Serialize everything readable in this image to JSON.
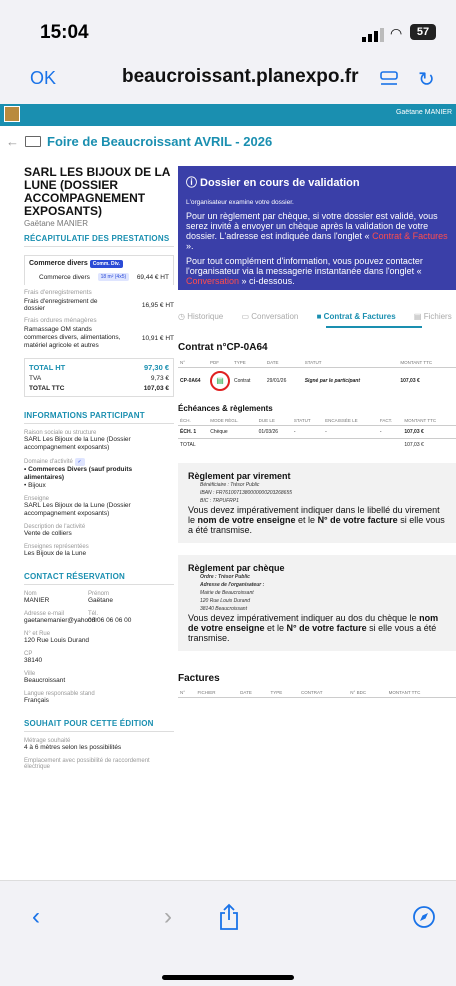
{
  "status": {
    "time": "15:04",
    "battery": "57"
  },
  "browser": {
    "ok": "OK",
    "url": "beaucroissant.planexpo.fr"
  },
  "header": {
    "user": "Gaëtane MANIER",
    "crumb": "Foire de Beaucroissant AVRIL - 2026"
  },
  "left": {
    "company": "SARL LES BIJOUX DE LA LUNE (DOSSIER ACCOMPAGNEMENT EXPOSANTS)",
    "contact": "Gaëtane MANIER",
    "recap_title": "RÉCAPITULATIF DES PRESTATIONS",
    "commerce_title": "Commerce divers",
    "commerce_tag": "Comm. Div.",
    "commerce_line": "Commerce divers",
    "commerce_tag2": "18 m² (4x5)",
    "commerce_price": "69,44 € HT",
    "frais_title": "Frais d'enregistrements",
    "frais_line": "Frais d'enregistrement de dossier",
    "frais_price": "16,95 € HT",
    "ordures_title": "Frais ordures ménagères",
    "ordures_line": "Ramassage OM stands commerces divers, alimentations, matériel agricole et autres",
    "ordures_price": "10,91 € HT",
    "total_ht_label": "TOTAL HT",
    "total_ht": "97,30 €",
    "tva_label": "TVA",
    "tva": "9,73 €",
    "total_ttc_label": "TOTAL TTC",
    "total_ttc": "107,03 €",
    "info_title": "INFORMATIONS PARTICIPANT",
    "raison_label": "Raison sociale ou structure",
    "raison": "SARL Les Bijoux de la Lune (Dossier accompagnement exposants)",
    "domaine_label": "Domaine d'activité",
    "domaine_1": "• Commerces Divers (sauf produits alimentaires)",
    "domaine_2": "• Bijoux",
    "enseigne_label": "Enseigne",
    "enseigne": "SARL Les Bijoux de la Lune (Dossier accompagnement exposants)",
    "desc_label": "Description de l'activité",
    "desc": "Vente de colliers",
    "enseignes_rep_label": "Enseignes représentées",
    "enseignes_rep": "Les Bijoux de la Lune",
    "contact_title": "CONTACT RÉSERVATION",
    "nom_label": "Nom",
    "nom": "MANIER",
    "prenom_label": "Prénom",
    "prenom": "Gaëtane",
    "email_label": "Adresse e-mail",
    "email": "gaetanemanier@yahoo.fr",
    "tel_label": "Tél.",
    "tel": "06 06 06 06 00",
    "rue_label": "N° et Rue",
    "rue": "120 Rue Louis Durand",
    "cp_label": "CP",
    "cp": "38140",
    "ville_label": "Ville",
    "ville": "Beaucroissant",
    "langue_label": "Langue responsable stand",
    "langue": "Français",
    "souhait_title": "SOUHAIT POUR CETTE ÉDITION",
    "metrage_label": "Métrage souhaité",
    "metrage": "4 à 6 mètres selon les possibilités",
    "emplacement_label": "Emplacement avec possibilité de raccordement électrique"
  },
  "right": {
    "banner_title": "ⓘ Dossier en cours de validation",
    "banner_sub": "L'organisateur examine votre dossier.",
    "banner_p1a": "Pour un règlement par chèque, si votre dossier est validé, vous serez invité à envoyer un chèque après la validation de votre dossier. L'adresse est indiquée dans l'onglet «",
    "banner_p1_link": "Contrat & Factures",
    "banner_p1b": "».",
    "banner_p2a": "Pour tout complément d'information, vous pouvez contacter l'organisateur via la messagerie instantanée dans l'onglet «",
    "banner_p2_link": "Conversation",
    "banner_p2b": "» ci-dessous.",
    "tabs": [
      "Historique",
      "Conversation",
      "Contrat & Factures",
      "Fichiers"
    ],
    "contrat_title": "Contrat n°CP-0A64",
    "contrat_headers": [
      "N°",
      "PDF",
      "TYPE",
      "DATE",
      "STATUT",
      "MONTANT TTC"
    ],
    "contrat_row": [
      "CP-0A64",
      "",
      "Contrat",
      "29/01/26",
      "Signé par le participant",
      "107,03 €"
    ],
    "ech_title": "Échéances & règlements",
    "ech_headers": [
      "ÉCH.",
      "MODE RÈGL.",
      "DUE LE",
      "STATUT",
      "ENCAISSÉE LE",
      "FACT.",
      "MONTANT TTC"
    ],
    "ech_row": [
      "ÉCH. 1",
      "Chèque",
      "01/03/26",
      "-",
      "-",
      "-",
      "107,03 €"
    ],
    "ech_total_label": "TOTAL",
    "ech_total": "107,03 €",
    "virement_title": "Règlement par virement",
    "benef": "Bénéficiaire : Trésor Public",
    "iban": "IBAN : FR7610071380000000203268655",
    "bic": "BIC : TRPUFRP1",
    "virement_text_a": "Vous devez impérativement indiquer dans le libellé du virement le ",
    "virement_bold1": "nom de votre enseigne",
    "virement_text_b": " et le ",
    "virement_bold2": "N° de votre facture",
    "virement_text_c": " si elle vous a été transmise.",
    "cheque_title": "Règlement par chèque",
    "ordre": "Ordre : Trésor Public",
    "adresse_org": "Adresse de l'organisateur :",
    "adr1": "Mairie de Beaucroissant",
    "adr2": "120 Rue Louis Durand",
    "adr3": "38140 Beaucroissant",
    "cheque_text_a": "Vous devez impérativement indiquer au dos du chèque le ",
    "cheque_bold1": "nom de votre enseigne",
    "cheque_text_b": " et le ",
    "cheque_bold2": "N° de votre facture",
    "cheque_text_c": " si elle vous a été transmise.",
    "factures_title": "Factures",
    "factures_headers": [
      "N°",
      "FICHIER",
      "DATE",
      "TYPE",
      "CONTRAT",
      "N° BDC",
      "MONTANT TTC"
    ]
  }
}
